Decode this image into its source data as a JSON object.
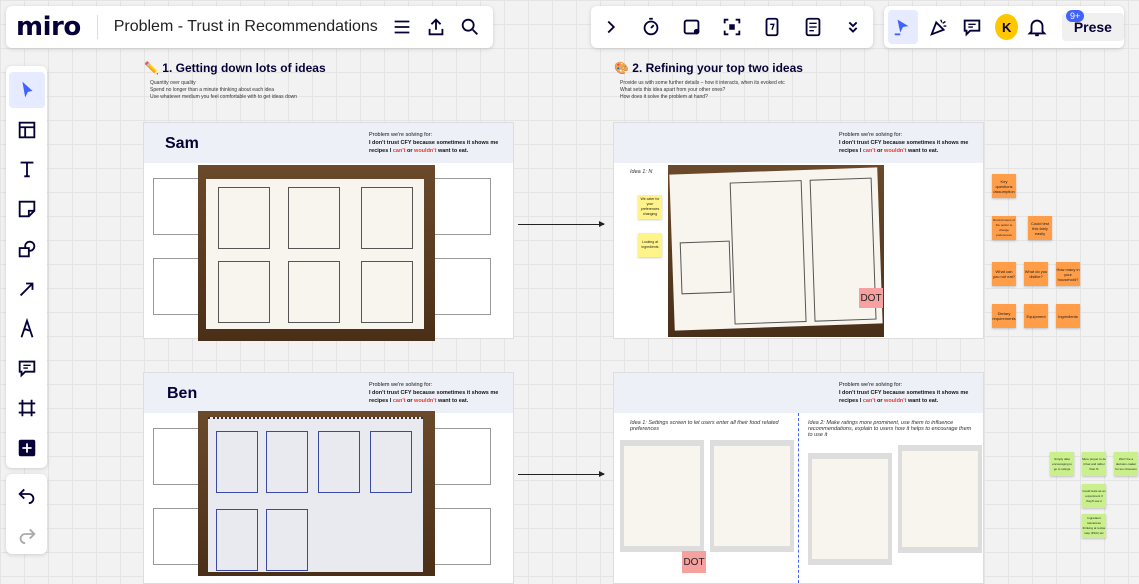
{
  "app": {
    "logo": "miro",
    "board_title": "Problem - Trust in Recommendations"
  },
  "top_right": {
    "avatar_initial": "K",
    "notif_badge": "9+",
    "present_label": "Prese"
  },
  "sections": {
    "s1": {
      "title": "✏️ 1. Getting down lots of ideas",
      "bullets": [
        "Quantity over quality",
        "Spend no longer than a minute thinking about each idea",
        "Use whatever medium you feel comfortable with to get ideas down"
      ]
    },
    "s2": {
      "title": "🎨 2. Refining your top two ideas",
      "bullets": [
        "Provide us with some further details – how it interacts, when its evoked etc",
        "What sets this idea apart from your other ones?",
        "How does it solve the problem at hand?"
      ]
    }
  },
  "problem": {
    "heading": "Problem we're solving for:",
    "line_start": "I don't trust CFY because sometimes it shows me recipes I",
    "cant": "can't",
    "or": "or",
    "wouldnt": "wouldn't",
    "line_end": "want to eat."
  },
  "frames": {
    "sam": "Sam",
    "ben": "Ben"
  },
  "ideas": {
    "sam_idea": "Idea 1: N",
    "ben_idea1": "Idea 1: Settings screen to let users enter all their food related preferences",
    "ben_idea2": "Idea 2: Make ratings more prominent, use them to influence recommendations, explain to users how it helps to encourage them to use it"
  },
  "dot_label": "DOT",
  "stickies_sam_left": [
    "We cater for your preferences changing",
    "Looking at ingredients"
  ],
  "stickies_orange": [
    "Key questions /assumption",
    "Remind users of the option to change preferences",
    "Could test this fairly easily",
    "What can you not eat?",
    "What do you dislike?",
    "How many in your household?",
    "Dietary requirements",
    "Equipment",
    "Ingredients"
  ],
  "stickies_green": [
    "Simply data encouraging to go to ratings",
    "More proper to do it fuel and rather than fit",
    "Won't be a decision-maker for too choosers",
    "Could tests as an experiment if they'll use it",
    "Ingredient tolerances thinking at recipe step (P&C) etc"
  ]
}
